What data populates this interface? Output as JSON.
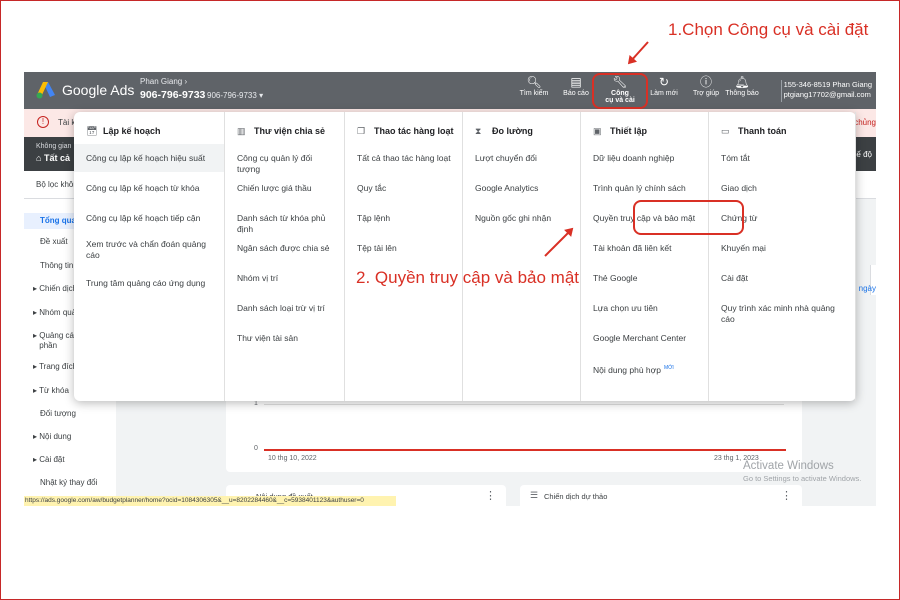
{
  "annotations": {
    "step1": "1.Chọn Công cụ và cài đặt",
    "step2": "2. Quyền truy cập và bảo mật"
  },
  "topbar": {
    "brand": "Google Ads",
    "account_name": "Phan Giang",
    "account_id": "906-796-9733",
    "account_id_small": "906-796-9733",
    "buttons": [
      {
        "label": "Tìm kiếm",
        "icon": "search-icon"
      },
      {
        "label": "Báo cáo",
        "icon": "reports-icon"
      },
      {
        "label": "Công\ncụ và cài",
        "icon": "wrench-icon"
      },
      {
        "label": "Làm mới",
        "icon": "refresh-icon"
      },
      {
        "label": "Trợ giúp",
        "icon": "help-icon"
      },
      {
        "label": "Thông báo",
        "icon": "bell-icon"
      }
    ],
    "user_id": "155-346-8519 Phan Giang",
    "user_email": "ptgiang17702@gmail.com"
  },
  "alert": {
    "text": "Tài k",
    "right": "chủng"
  },
  "darkbar": {
    "line1": "Không gian",
    "line2": "Tất cả",
    "right": "chế độ"
  },
  "filterbar": {
    "text": "Bộ lọc không"
  },
  "sidebar": {
    "items": [
      {
        "label": "Tổng quan",
        "expand": false
      },
      {
        "label": "Đề xuất",
        "expand": false
      },
      {
        "label": "Thông tin",
        "expand": false
      },
      {
        "label": "Chiến dịch",
        "expand": true
      },
      {
        "label": "Nhóm quả",
        "expand": true
      },
      {
        "label": "Quảng cáo\nphần",
        "expand": true
      },
      {
        "label": "Trang đích",
        "expand": true
      },
      {
        "label": "Từ khóa",
        "expand": true
      },
      {
        "label": "Đối tượng",
        "expand": false
      },
      {
        "label": "Nội dung",
        "expand": true
      },
      {
        "label": "Cài đặt",
        "expand": true
      },
      {
        "label": "Nhật ký thay đổi",
        "expand": false
      }
    ]
  },
  "right_link": "ngày",
  "chart": {
    "y_top": "1",
    "y_bottom": "0",
    "x_start": "10 thg 10, 2022",
    "x_end": "23 thg 1, 2023"
  },
  "bottom_cards": [
    {
      "title": "Nội dung đề xuất"
    },
    {
      "title": "Chiến dịch dự thảo"
    }
  ],
  "watermark": {
    "line1": "Activate Windows",
    "line2": "Go to Settings to activate Windows."
  },
  "statusbar": "https://ads.google.com/aw/budgetplanner/home?ocid=1084306305&__u=8202284460&__c=5938401123&authuser=0",
  "menu": {
    "columns": [
      {
        "title": "Lập kế hoạch",
        "icon": "calendar-icon",
        "items": [
          {
            "label": "Công cụ lập kế hoạch hiệu suất"
          },
          {
            "label": "Công cụ lập kế hoạch từ khóa"
          },
          {
            "label": "Công cụ lập kế hoạch tiếp cận"
          },
          {
            "label": "Xem trước và chẩn đoán quảng cáo"
          },
          {
            "label": "Trung tâm quảng cáo ứng dụng"
          }
        ]
      },
      {
        "title": "Thư viện chia sẻ",
        "icon": "library-icon",
        "items": [
          {
            "label": "Công cụ quản lý đối tượng"
          },
          {
            "label": "Chiến lược giá thầu"
          },
          {
            "label": "Danh sách từ khóa phủ định"
          },
          {
            "label": "Ngân sách được chia sẻ"
          },
          {
            "label": "Nhóm vị trí"
          },
          {
            "label": "Danh sách loại trừ vị trí"
          },
          {
            "label": "Thư viện tài sản"
          }
        ]
      },
      {
        "title": "Thao tác hàng loạt",
        "icon": "copy-icon",
        "items": [
          {
            "label": "Tất cả thao tác hàng loạt"
          },
          {
            "label": "Quy tắc"
          },
          {
            "label": "Tập lệnh"
          },
          {
            "label": "Tệp tải lên"
          }
        ]
      },
      {
        "title": "Đo lường",
        "icon": "hourglass-icon",
        "items": [
          {
            "label": "Lượt chuyển đổi"
          },
          {
            "label": "Google Analytics"
          },
          {
            "label": "Nguồn gốc ghi nhận"
          }
        ]
      },
      {
        "title": "Thiết lập",
        "icon": "setup-icon",
        "items": [
          {
            "label": "Dữ liệu doanh nghiệp"
          },
          {
            "label": "Trình quản lý chính sách"
          },
          {
            "label": "Quyền truy cập và bảo mật"
          },
          {
            "label": "Tài khoản đã liên kết"
          },
          {
            "label": "Thẻ Google"
          },
          {
            "label": "Lựa chọn ưu tiên"
          },
          {
            "label": "Google Merchant Center"
          },
          {
            "label": "Nội dung phù hợp",
            "badge": "MỚI"
          }
        ]
      },
      {
        "title": "Thanh toán",
        "icon": "card-icon",
        "items": [
          {
            "label": "Tóm tắt"
          },
          {
            "label": "Giao dịch"
          },
          {
            "label": "Chứng từ"
          },
          {
            "label": "Khuyến mại"
          },
          {
            "label": "Cài đặt"
          },
          {
            "label": "Quy trình xác minh nhà quảng cáo"
          }
        ]
      }
    ]
  }
}
